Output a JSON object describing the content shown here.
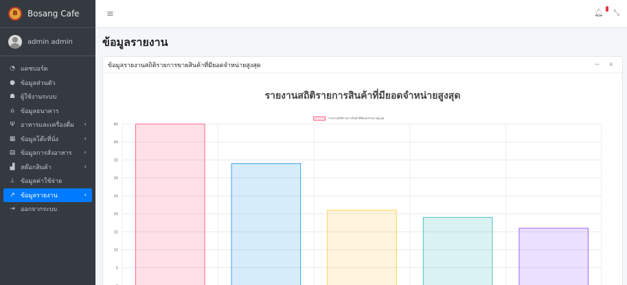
{
  "brand": {
    "name": "Bosang Cafe"
  },
  "user": {
    "name": "admin admin"
  },
  "nav": [
    {
      "label": "แดชบอร์ด",
      "icon": "dashboard-icon",
      "glyph": "◔",
      "chevron": false,
      "active": false
    },
    {
      "label": "ข้อมูลส่วนตัว",
      "icon": "user-circle-icon",
      "glyph": "●",
      "chevron": false,
      "active": false
    },
    {
      "label": "ผู้ใช้งานระบบ",
      "icon": "users-icon",
      "glyph": "☗",
      "chevron": false,
      "active": false
    },
    {
      "label": "ข้อมูลธนาคาร",
      "icon": "bank-icon",
      "glyph": "⌂",
      "chevron": false,
      "active": false
    },
    {
      "label": "อาหารและเครื่องดื่ม",
      "icon": "utensils-icon",
      "glyph": "Ψ",
      "chevron": true,
      "active": false
    },
    {
      "label": "ข้อมูลโต๊ะที่นั่ง",
      "icon": "table-icon",
      "glyph": "▦",
      "chevron": true,
      "active": false
    },
    {
      "label": "ข้อมูลการสั่งอาหาร",
      "icon": "clipboard-icon",
      "glyph": "▤",
      "chevron": true,
      "active": false
    },
    {
      "label": "สต๊อกสินค้า",
      "icon": "boxes-icon",
      "glyph": "▟",
      "chevron": true,
      "active": false
    },
    {
      "label": "ข้อมูลค่าใช้จ่าย",
      "icon": "hand-holding-icon",
      "glyph": "⊥",
      "chevron": false,
      "active": false
    },
    {
      "label": "ข้อมูลรายงาน",
      "icon": "chart-line-icon",
      "glyph": "↗",
      "chevron": true,
      "active": true
    },
    {
      "label": "ออกจากระบบ",
      "icon": "sign-out-icon",
      "glyph": "⇥",
      "chevron": false,
      "active": false
    }
  ],
  "topbar": {
    "menu_glyph": "≡",
    "bell_glyph": "♫",
    "badge": "",
    "expand_glyph": "⤡"
  },
  "page": {
    "title": "ข้อมูลรายงาน"
  },
  "card": {
    "title": "ข้อมูลรายงานสถิติรายการขายสินค้าที่มียอดจำหน่ายสูงสุด",
    "collapse": "−",
    "close": "×"
  },
  "chart_data": {
    "type": "bar",
    "title": "รายงานสถิติรายการสินค้าที่มียอดจำหน่ายสูงสุด",
    "series": [
      {
        "name": "รายงานสถิติรายการสินค้าที่มียอดจำหน่ายสูงสุด",
        "values": [
          45,
          34,
          21,
          19,
          16
        ]
      }
    ],
    "categories": [
      "",
      "",
      "",
      "",
      ""
    ],
    "bar_fill": [
      "rgba(255,99,132,0.2)",
      "rgba(54,162,235,0.2)",
      "rgba(255,206,86,0.2)",
      "rgba(75,192,192,0.2)",
      "rgba(153,102,255,0.2)"
    ],
    "bar_stroke": [
      "rgba(255,99,132,1)",
      "rgba(54,162,235,1)",
      "rgba(255,206,86,1)",
      "rgba(75,192,192,1)",
      "rgba(153,102,255,1)"
    ],
    "yticks": [
      0,
      5,
      10,
      15,
      20,
      25,
      30,
      35,
      40,
      45
    ],
    "ylim": [
      0,
      45
    ],
    "grid": true,
    "legend": "top"
  }
}
